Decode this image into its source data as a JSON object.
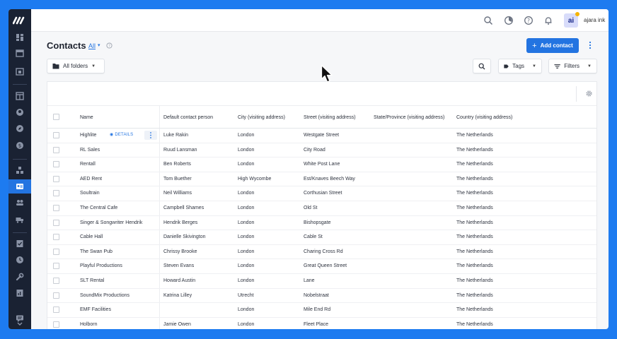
{
  "topbar": {
    "avatar_initials": "ai",
    "org_name": "ajara ink",
    "icons": [
      "search-icon",
      "timer-icon",
      "help-icon",
      "bell-icon"
    ]
  },
  "header": {
    "title": "Contacts",
    "filter_link": "All",
    "add_button": "Add contact"
  },
  "toolbar": {
    "folders_label": "All folders",
    "tags_label": "Tags",
    "filters_label": "Filters"
  },
  "table": {
    "columns": [
      "Name",
      "Default contact person",
      "City (visiting address)",
      "Street (visiting address)",
      "State/Province (visiting address)",
      "Country (visiting address)"
    ],
    "details_label": "DETAILS",
    "rows": [
      {
        "name": "Highlite",
        "contact": "Luke Rakin",
        "city": "London",
        "street": "Westgate Street",
        "state": "",
        "country": "The Netherlands"
      },
      {
        "name": "RL Sales",
        "contact": "Ruud Lansman",
        "city": "London",
        "street": "City Road",
        "state": "",
        "country": "The Netherlands"
      },
      {
        "name": "Rentall",
        "contact": "Ben Roberts",
        "city": "London",
        "street": "White Post Lane",
        "state": "",
        "country": "The Netherlands"
      },
      {
        "name": "AED Rent",
        "contact": "Tom Buether",
        "city": "High Wycombe",
        "street": "Est/Knaves Beech Way",
        "state": "",
        "country": "The Netherlands"
      },
      {
        "name": "Soultrain",
        "contact": "Neil Williams",
        "city": "London",
        "street": "Corthusian Street",
        "state": "",
        "country": "The Netherlands"
      },
      {
        "name": "The Central Cafe",
        "contact": "Campbell Shames",
        "city": "London",
        "street": "Old St",
        "state": "",
        "country": "The Netherlands"
      },
      {
        "name": "Singer & Songwriter Hendrik",
        "contact": "Hendrik Berges",
        "city": "London",
        "street": "Bishopsgate",
        "state": "",
        "country": "The Netherlands"
      },
      {
        "name": "Cable Hall",
        "contact": "Danielle Skivington",
        "city": "London",
        "street": "Cable St",
        "state": "",
        "country": "The Netherlands"
      },
      {
        "name": "The Swan Pub",
        "contact": "Chrissy Brooke",
        "city": "London",
        "street": "Charing Cross Rd",
        "state": "",
        "country": "The Netherlands"
      },
      {
        "name": "Playful Productions",
        "contact": "Steven Evans",
        "city": "London",
        "street": "Great Queen Street",
        "state": "",
        "country": "The Netherlands"
      },
      {
        "name": "SLT Rental",
        "contact": "Howard Austin",
        "city": "London",
        "street": "Lane",
        "state": "",
        "country": "The Netherlands"
      },
      {
        "name": "SoundMix Productions",
        "contact": "Katrina Lilley",
        "city": "Utrecht",
        "street": "Nobelstraat",
        "state": "",
        "country": "The Netherlands"
      },
      {
        "name": "EMF Facilities",
        "contact": "",
        "city": "London",
        "street": "Mile End Rd",
        "state": "",
        "country": "The Netherlands"
      },
      {
        "name": "Holborn",
        "contact": "Jamie Owen",
        "city": "London",
        "street": "Fleet Place",
        "state": "",
        "country": "The Netherlands"
      }
    ]
  },
  "colors": {
    "accent": "#2374e1",
    "sidebar": "#1a2233",
    "background": "#1d7bf0"
  }
}
